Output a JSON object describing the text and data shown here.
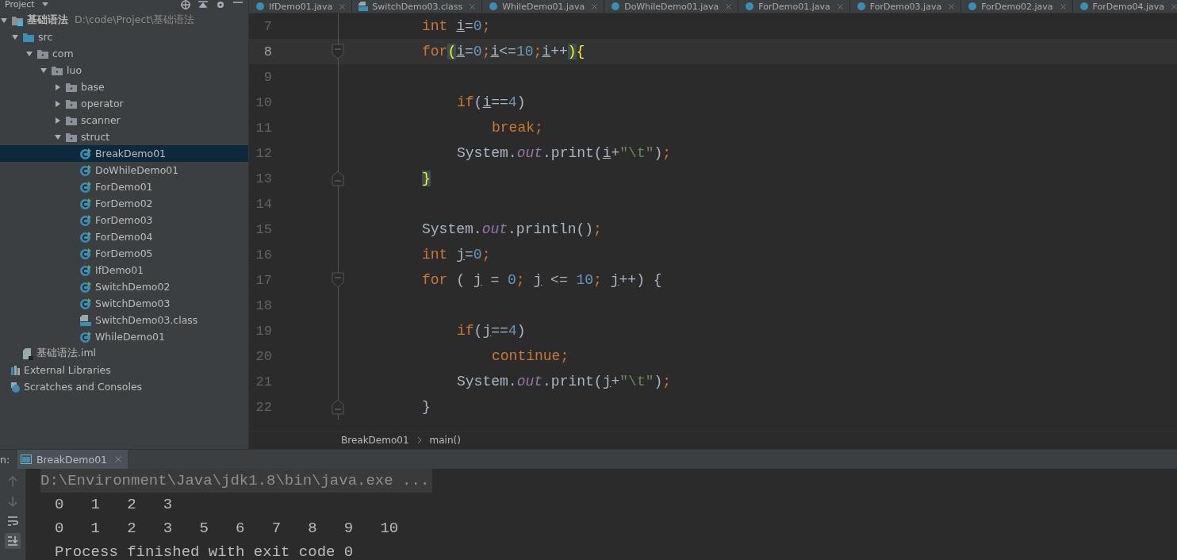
{
  "sidebar": {
    "title": "Project",
    "tree": [
      {
        "label": "基础语法",
        "path": "D:\\code\\Project\\基础语法",
        "kind": "module",
        "expanded": true,
        "selected": false,
        "children": [
          {
            "label": "src",
            "kind": "source",
            "expanded": true,
            "selected": false,
            "children": [
              {
                "label": "com",
                "kind": "package",
                "expanded": true,
                "selected": false,
                "children": [
                  {
                    "label": "luo",
                    "kind": "package",
                    "expanded": true,
                    "selected": false,
                    "children": [
                      {
                        "label": "base",
                        "kind": "package",
                        "expanded": false,
                        "selected": false
                      },
                      {
                        "label": "operator",
                        "kind": "package",
                        "expanded": false,
                        "selected": false
                      },
                      {
                        "label": "scanner",
                        "kind": "package",
                        "expanded": false,
                        "selected": false
                      },
                      {
                        "label": "struct",
                        "kind": "package",
                        "expanded": true,
                        "selected": false,
                        "children": [
                          {
                            "label": "BreakDemo01",
                            "kind": "class",
                            "selected": true
                          },
                          {
                            "label": "DoWhileDemo01",
                            "kind": "class",
                            "selected": false
                          },
                          {
                            "label": "ForDemo01",
                            "kind": "class",
                            "selected": false
                          },
                          {
                            "label": "ForDemo02",
                            "kind": "class",
                            "selected": false
                          },
                          {
                            "label": "ForDemo03",
                            "kind": "class",
                            "selected": false
                          },
                          {
                            "label": "ForDemo04",
                            "kind": "class",
                            "selected": false
                          },
                          {
                            "label": "ForDemo05",
                            "kind": "class",
                            "selected": false
                          },
                          {
                            "label": "IfDemo01",
                            "kind": "class",
                            "selected": false
                          },
                          {
                            "label": "SwitchDemo02",
                            "kind": "class",
                            "selected": false
                          },
                          {
                            "label": "SwitchDemo03",
                            "kind": "class",
                            "selected": false
                          },
                          {
                            "label": "SwitchDemo03.class",
                            "kind": "classfile",
                            "selected": false
                          },
                          {
                            "label": "WhileDemo01",
                            "kind": "class",
                            "selected": false
                          }
                        ]
                      }
                    ]
                  }
                ]
              }
            ]
          },
          {
            "label": "基础语法.iml",
            "kind": "iml",
            "selected": false
          }
        ]
      },
      {
        "label": "External Libraries",
        "kind": "libraries",
        "selected": false
      },
      {
        "label": "Scratches and Consoles",
        "kind": "scratches",
        "selected": false
      }
    ]
  },
  "tabs": [
    {
      "label": "IfDemo01.java",
      "kind": "class",
      "selected": false
    },
    {
      "label": "SwitchDemo03.class",
      "kind": "classfile",
      "selected": false
    },
    {
      "label": "WhileDemo01.java",
      "kind": "class",
      "selected": false
    },
    {
      "label": "DoWhileDemo01.java",
      "kind": "class",
      "selected": false
    },
    {
      "label": "ForDemo01.java",
      "kind": "class",
      "selected": false
    },
    {
      "label": "ForDemo03.java",
      "kind": "class",
      "selected": false
    },
    {
      "label": "ForDemo02.java",
      "kind": "class",
      "selected": false
    },
    {
      "label": "ForDemo04.java",
      "kind": "class",
      "selected": false
    }
  ],
  "editor": {
    "lines": [
      {
        "number": "7",
        "current": false,
        "kind": "code",
        "tokens": [
          {
            "t": "int ",
            "kind": "keyword"
          },
          {
            "t": "i",
            "kind": "var"
          },
          {
            "t": "=",
            "kind": "plain"
          },
          {
            "t": "0",
            "kind": "number"
          },
          {
            "t": ";",
            "kind": "keyword"
          }
        ]
      },
      {
        "number": "8",
        "current": true,
        "kind": "fold-start",
        "tokens": [
          {
            "t": "for",
            "kind": "keyword"
          },
          {
            "t": "(",
            "kind": "match"
          },
          {
            "t": "i",
            "kind": "var"
          },
          {
            "t": "=",
            "kind": "plain"
          },
          {
            "t": "0",
            "kind": "number"
          },
          {
            "t": ";",
            "kind": "keyword"
          },
          {
            "t": "i",
            "kind": "var"
          },
          {
            "t": "<=",
            "kind": "plain"
          },
          {
            "t": "10",
            "kind": "number"
          },
          {
            "t": ";",
            "kind": "keyword"
          },
          {
            "t": "i",
            "kind": "var"
          },
          {
            "t": "++",
            "kind": "plain"
          },
          {
            "t": ")",
            "kind": "match"
          },
          {
            "t": "{",
            "kind": "brace"
          }
        ],
        "children": [
          {
            "number": "9",
            "current": false,
            "kind": "code"
          },
          {
            "number": "10",
            "current": false,
            "kind": "code",
            "tokens": [
              {
                "t": "if",
                "kind": "keyword"
              },
              {
                "t": "(",
                "kind": "plain"
              },
              {
                "t": "i",
                "kind": "var"
              },
              {
                "t": "==",
                "kind": "plain"
              },
              {
                "t": "4",
                "kind": "number"
              },
              {
                "t": ")",
                "kind": "plain"
              }
            ],
            "children": [
              {
                "number": "11",
                "current": false,
                "kind": "code",
                "tokens": [
                  {
                    "t": "break;",
                    "kind": "keyword"
                  }
                ]
              }
            ]
          },
          {
            "number": "12",
            "current": false,
            "kind": "code",
            "tokens": [
              {
                "t": "System.",
                "kind": "plain"
              },
              {
                "t": "out",
                "kind": "field"
              },
              {
                "t": ".print(",
                "kind": "plain"
              },
              {
                "t": "i",
                "kind": "var"
              },
              {
                "t": "+",
                "kind": "plain"
              },
              {
                "t": "\"\\t\"",
                "kind": "string"
              },
              {
                "t": ")",
                "kind": "plain"
              },
              {
                "t": ";",
                "kind": "keyword"
              }
            ]
          }
        ]
      },
      {
        "number": "13",
        "current": false,
        "kind": "fold-end",
        "tokens": [
          {
            "t": "}",
            "kind": "match"
          }
        ]
      },
      {
        "number": "14",
        "current": false,
        "kind": "code"
      },
      {
        "number": "15",
        "current": false,
        "kind": "code",
        "tokens": [
          {
            "t": "System.",
            "kind": "plain"
          },
          {
            "t": "out",
            "kind": "field"
          },
          {
            "t": ".println()",
            "kind": "plain"
          },
          {
            "t": ";",
            "kind": "keyword"
          }
        ]
      },
      {
        "number": "16",
        "current": false,
        "kind": "code",
        "tokens": [
          {
            "t": "int ",
            "kind": "keyword"
          },
          {
            "t": "j",
            "kind": "var"
          },
          {
            "t": "=",
            "kind": "plain"
          },
          {
            "t": "0",
            "kind": "number"
          },
          {
            "t": ";",
            "kind": "keyword"
          }
        ]
      },
      {
        "number": "17",
        "current": false,
        "kind": "fold-start",
        "tokens": [
          {
            "t": "for ",
            "kind": "keyword"
          },
          {
            "t": "( ",
            "kind": "plain"
          },
          {
            "t": "j",
            "kind": "var"
          },
          {
            "t": " = ",
            "kind": "plain"
          },
          {
            "t": "0",
            "kind": "number"
          },
          {
            "t": "; ",
            "kind": "keyword"
          },
          {
            "t": "j",
            "kind": "var"
          },
          {
            "t": " <= ",
            "kind": "plain"
          },
          {
            "t": "10",
            "kind": "number"
          },
          {
            "t": "; ",
            "kind": "keyword"
          },
          {
            "t": "j",
            "kind": "var"
          },
          {
            "t": "++) {",
            "kind": "plain"
          }
        ],
        "children": [
          {
            "number": "18",
            "current": false,
            "kind": "code"
          },
          {
            "number": "19",
            "current": false,
            "kind": "code",
            "tokens": [
              {
                "t": "if",
                "kind": "keyword"
              },
              {
                "t": "(",
                "kind": "plain"
              },
              {
                "t": "j",
                "kind": "var"
              },
              {
                "t": "==",
                "kind": "plain"
              },
              {
                "t": "4",
                "kind": "number"
              },
              {
                "t": ")",
                "kind": "plain"
              }
            ],
            "children": [
              {
                "number": "20",
                "current": false,
                "kind": "code",
                "tokens": [
                  {
                    "t": "continue;",
                    "kind": "keyword"
                  }
                ]
              }
            ]
          },
          {
            "number": "21",
            "current": false,
            "kind": "code",
            "tokens": [
              {
                "t": "System.",
                "kind": "plain"
              },
              {
                "t": "out",
                "kind": "field"
              },
              {
                "t": ".print(",
                "kind": "plain"
              },
              {
                "t": "j",
                "kind": "var"
              },
              {
                "t": "+",
                "kind": "plain"
              },
              {
                "t": "\"\\t\"",
                "kind": "string"
              },
              {
                "t": ")",
                "kind": "plain"
              },
              {
                "t": ";",
                "kind": "keyword"
              }
            ]
          }
        ]
      },
      {
        "number": "22",
        "current": false,
        "kind": "fold-end",
        "tokens": [
          {
            "t": "}",
            "kind": "plain"
          }
        ]
      }
    ],
    "breadcrumbs": [
      "BreakDemo01",
      "main()"
    ]
  },
  "run": {
    "label": "n:",
    "tabs": [
      {
        "label": "BreakDemo01",
        "selected": true
      }
    ],
    "tools": [
      {
        "kind": "up",
        "on": false
      },
      {
        "kind": "down",
        "on": false
      },
      {
        "kind": "wrap",
        "on": false
      },
      {
        "kind": "scroll",
        "on": true
      }
    ],
    "output": [
      {
        "text": "D:\\Environment\\Java\\jdk1.8\\bin\\java.exe ...",
        "kind": "command"
      },
      {
        "text": "0\t1\t2\t3",
        "kind": "out"
      },
      {
        "text": "0\t1\t2\t3\t5\t6\t7\t8\t9\t10",
        "kind": "out"
      },
      {
        "text": "Process finished with exit code 0",
        "kind": "out"
      }
    ]
  }
}
